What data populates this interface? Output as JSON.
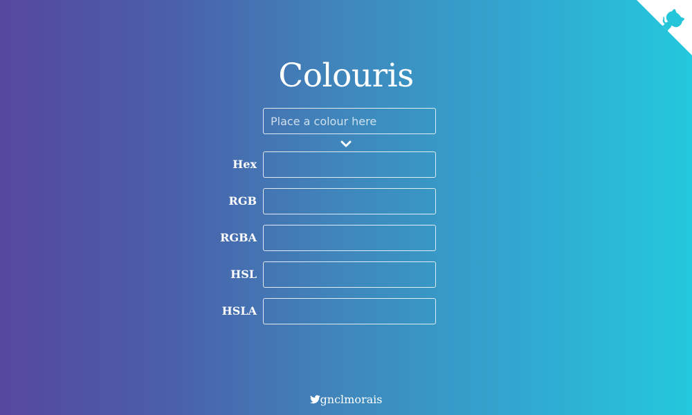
{
  "colors": {
    "gradient_start": "#56479f",
    "gradient_end": "#24c8dd",
    "text": "#ffffff"
  },
  "corner": {
    "icon": "github-icon"
  },
  "header": {
    "title": "Colouris"
  },
  "main_input": {
    "value": "",
    "placeholder": "Place a colour here"
  },
  "convert_icon": "chevron-down-icon",
  "formats": [
    {
      "label": "Hex",
      "value": ""
    },
    {
      "label": "RGB",
      "value": ""
    },
    {
      "label": "RGBA",
      "value": ""
    },
    {
      "label": "HSL",
      "value": ""
    },
    {
      "label": "HSLA",
      "value": ""
    }
  ],
  "footer": {
    "icon": "twitter-icon",
    "handle": "gnclmorais"
  }
}
